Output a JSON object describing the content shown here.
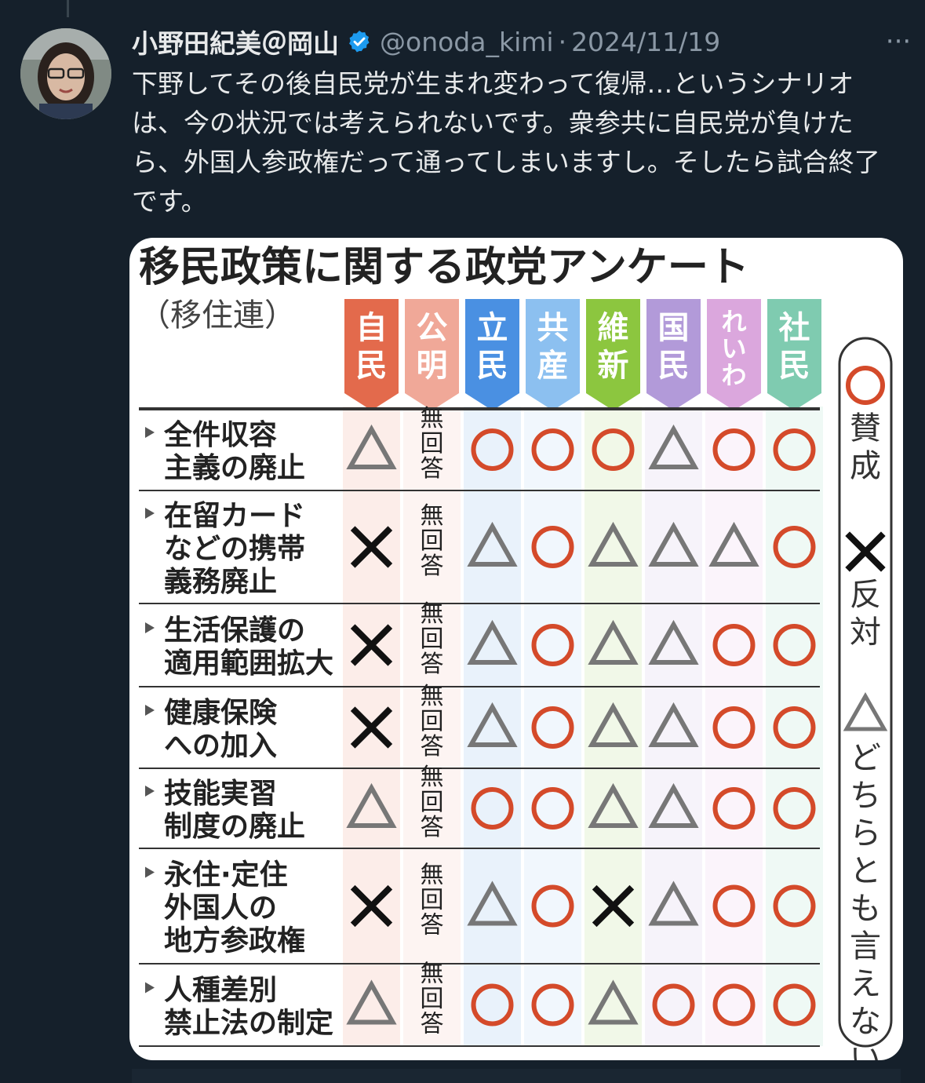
{
  "tweet": {
    "display_name": "小野田紀美＠岡山",
    "handle": "@onoda_kimi",
    "separator": "·",
    "date": "2024/11/19",
    "more_label": "···",
    "text": "下野してその後自民党が生まれ変わって復帰…というシナリオは、今の状況では考えられないです。衆参共に自民党が負けたら、外国人参政権だって通ってしまいますし。そしたら試合終了です。"
  },
  "chart_data": {
    "type": "table",
    "title": "移民政策に関する政党アンケート",
    "subtitle": "（移住連）",
    "parties": [
      {
        "name": "自民",
        "color": "#e36a4c"
      },
      {
        "name": "公明",
        "color": "#f0a898"
      },
      {
        "name": "立民",
        "color": "#4a90e2"
      },
      {
        "name": "共産",
        "color": "#8cc0f0"
      },
      {
        "name": "維新",
        "color": "#8cc63f"
      },
      {
        "name": "国民",
        "color": "#b29ad9"
      },
      {
        "name": "れいわ",
        "color": "#dba7dd"
      },
      {
        "name": "社民",
        "color": "#7fcbb0"
      }
    ],
    "rows": [
      {
        "label": "全件収容\n主義の廃止",
        "answers": [
          "△",
          "無回答",
          "○",
          "○",
          "○",
          "△",
          "○",
          "○"
        ]
      },
      {
        "label": "在留カード\nなどの携帯\n義務廃止",
        "answers": [
          "×",
          "無回答",
          "△",
          "○",
          "△",
          "△",
          "△",
          "○"
        ]
      },
      {
        "label": "生活保護の\n適用範囲拡大",
        "answers": [
          "×",
          "無回答",
          "△",
          "○",
          "△",
          "△",
          "○",
          "○"
        ]
      },
      {
        "label": "健康保険\nへの加入",
        "answers": [
          "×",
          "無回答",
          "△",
          "○",
          "△",
          "△",
          "○",
          "○"
        ]
      },
      {
        "label": "技能実習\n制度の廃止",
        "answers": [
          "△",
          "無回答",
          "○",
          "○",
          "△",
          "△",
          "○",
          "○"
        ]
      },
      {
        "label": "永住·定住\n外国人の\n地方参政権",
        "answers": [
          "×",
          "無回答",
          "△",
          "○",
          "×",
          "△",
          "○",
          "○"
        ]
      },
      {
        "label": "人種差別\n禁止法の制定",
        "answers": [
          "△",
          "無回答",
          "○",
          "○",
          "△",
          "○",
          "○",
          "○"
        ]
      }
    ],
    "legend": [
      {
        "symbol": "○",
        "label": "賛成"
      },
      {
        "symbol": "×",
        "label": "反対"
      },
      {
        "symbol": "△",
        "label": "どちらとも言えない"
      }
    ],
    "colors": {
      "circle": "#d44a2a",
      "triangle": "#777777",
      "cross": "#111111"
    }
  }
}
